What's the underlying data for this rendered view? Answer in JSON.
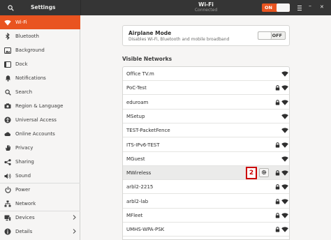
{
  "header": {
    "app_title": "Settings",
    "panel_title": "Wi-Fi",
    "panel_subtitle": "Connected",
    "wifi_switch_label": "ON",
    "minimize_glyph": "–",
    "close_glyph": "✕"
  },
  "sidebar": {
    "items": [
      {
        "label": "Wi-Fi",
        "icon": "wifi-icon"
      },
      {
        "label": "Bluetooth",
        "icon": "bluetooth-icon"
      },
      {
        "label": "Background",
        "icon": "background-icon"
      },
      {
        "label": "Dock",
        "icon": "dock-icon"
      },
      {
        "label": "Notifications",
        "icon": "bell-icon"
      },
      {
        "label": "Search",
        "icon": "search-icon"
      },
      {
        "label": "Region & Language",
        "icon": "camera-icon"
      },
      {
        "label": "Universal Access",
        "icon": "accessibility-icon"
      },
      {
        "label": "Online Accounts",
        "icon": "cloud-icon"
      },
      {
        "label": "Privacy",
        "icon": "hand-icon"
      },
      {
        "label": "Sharing",
        "icon": "share-icon"
      },
      {
        "label": "Sound",
        "icon": "speaker-icon"
      },
      {
        "label": "Power",
        "icon": "power-icon"
      },
      {
        "label": "Network",
        "icon": "network-icon"
      },
      {
        "label": "Devices",
        "icon": "devices-icon"
      },
      {
        "label": "Details",
        "icon": "details-icon"
      }
    ]
  },
  "airplane": {
    "title": "Airplane Mode",
    "subtitle": "Disables Wi-Fi, Bluetooth and mobile broadband",
    "switch_label": "OFF"
  },
  "networks": {
    "title": "Visible Networks",
    "callout": "2",
    "items": [
      {
        "name": "Office TV.m",
        "locked": false
      },
      {
        "name": "PoC-Test",
        "locked": true
      },
      {
        "name": "eduroam",
        "locked": true
      },
      {
        "name": "MSetup",
        "locked": false
      },
      {
        "name": "TEST-PacketFence",
        "locked": false
      },
      {
        "name": "ITS-IPv6-TEST",
        "locked": true
      },
      {
        "name": "MGuest",
        "locked": false
      },
      {
        "name": "MWireless",
        "locked": true
      },
      {
        "name": "arbl2-2215",
        "locked": true
      },
      {
        "name": "arbl2-lab",
        "locked": true
      },
      {
        "name": "MFleet",
        "locked": true
      },
      {
        "name": "UMHS-WPA-PSK",
        "locked": true
      }
    ]
  },
  "colors": {
    "accent": "#e95420",
    "headerbar": "#353535",
    "callout": "#cc0000"
  }
}
